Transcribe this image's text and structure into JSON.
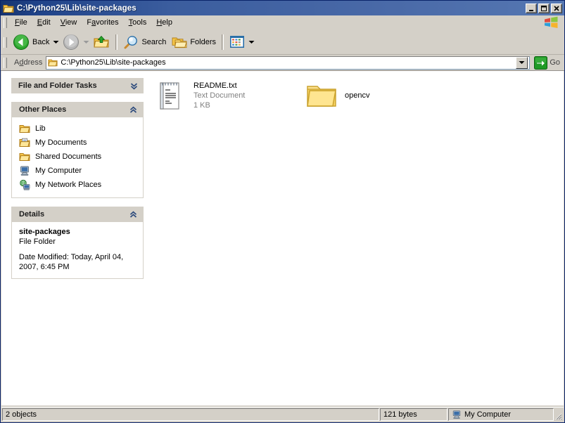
{
  "window": {
    "title": "C:\\Python25\\Lib\\site-packages",
    "title_icon": "folder-open-icon",
    "minimize_label": "Minimize",
    "maximize_label": "Maximize",
    "close_label": "Close"
  },
  "menu": {
    "items": [
      {
        "label": "File",
        "accesskey": "F"
      },
      {
        "label": "Edit",
        "accesskey": "E"
      },
      {
        "label": "View",
        "accesskey": "V"
      },
      {
        "label": "Favorites",
        "accesskey": "a"
      },
      {
        "label": "Tools",
        "accesskey": "T"
      },
      {
        "label": "Help",
        "accesskey": "H"
      }
    ]
  },
  "toolbar": {
    "back_label": "Back",
    "forward_label": "",
    "up_label": "",
    "search_label": "Search",
    "folders_label": "Folders",
    "views_label": ""
  },
  "address": {
    "label": "Address",
    "value": "C:\\Python25\\Lib\\site-packages",
    "go_label": "Go"
  },
  "sidebar": {
    "panels": [
      {
        "title": "File and Folder Tasks",
        "state": "collapsed",
        "chevron": "chevron-double-down-icon",
        "items": []
      },
      {
        "title": "Other Places",
        "state": "expanded",
        "chevron": "chevron-double-up-icon",
        "items": [
          {
            "label": "Lib",
            "icon": "folder-icon"
          },
          {
            "label": "My Documents",
            "icon": "my-documents-icon"
          },
          {
            "label": "Shared Documents",
            "icon": "shared-folder-icon"
          },
          {
            "label": "My Computer",
            "icon": "computer-icon"
          },
          {
            "label": "My Network Places",
            "icon": "network-icon"
          }
        ]
      },
      {
        "title": "Details",
        "state": "expanded",
        "chevron": "chevron-double-up-icon",
        "details": {
          "name": "site-packages",
          "type": "File Folder",
          "date_modified": "Date Modified: Today, April 04, 2007, 6:45 PM"
        }
      }
    ]
  },
  "files": {
    "view": "tiles",
    "items": [
      {
        "name": "README.txt",
        "type": "Text Document",
        "size": "1 KB",
        "icon": "text-document-icon"
      },
      {
        "name": "opencv",
        "type": "",
        "size": "",
        "icon": "folder-icon"
      }
    ]
  },
  "statusbar": {
    "object_count": "2 objects",
    "total_size": "121 bytes",
    "zone": "My Computer",
    "zone_icon": "computer-icon"
  },
  "colors": {
    "titlebar_start": "#16336e",
    "titlebar_end": "#5577b2",
    "chrome": "#d4d0c8",
    "panel_header": "#d4d0c8",
    "folder_yellow": "#ffd24d",
    "go_green": "#1f9a25",
    "back_green": "#2fae30",
    "muted_text": "#808080"
  }
}
